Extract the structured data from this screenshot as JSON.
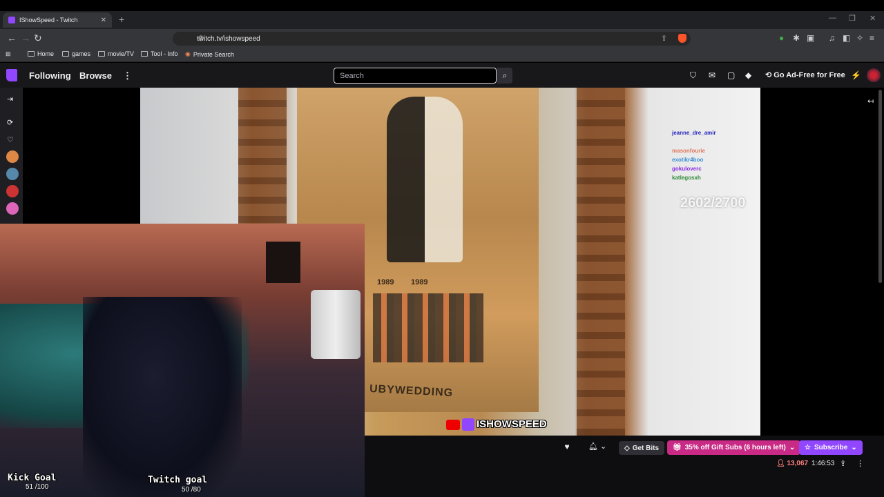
{
  "browser": {
    "tab_title": "IShowSpeed - Twitch",
    "tab_close": "✕",
    "new_tab": "+",
    "url": "twitch.tv/ishowspeed",
    "bookmarks": [
      "Home",
      "games",
      "movie/TV",
      "Tool - Info",
      "Private Search"
    ]
  },
  "twitch_nav": {
    "following": "Following",
    "browse": "Browse",
    "more": "⋮",
    "search_placeholder": "Search",
    "ad_free": "Go Ad-Free for Free"
  },
  "stream": {
    "chat_names": [
      {
        "name": "jeanne_dre_amir",
        "color": "#1f1fbf"
      },
      {
        "name": "masonfourie",
        "color": "#e0785a"
      },
      {
        "name": "exotikr4boo",
        "color": "#3a8fd6"
      },
      {
        "name": "gokuloverc",
        "color": "#8a2be2"
      },
      {
        "name": "katlegosxh",
        "color": "#2e8b3a"
      }
    ],
    "counter": "2602/2700",
    "watermark": "ISHOWSPEED",
    "photo_caption": "UBYWEDDING",
    "years": [
      "1989",
      "1989"
    ]
  },
  "webcam": {
    "kick_label": "Kick Goal",
    "kick_value": "51 /100",
    "twitch_label": "Twitch goal",
    "twitch_value": "50 /80"
  },
  "actions": {
    "get_bits": "Get Bits",
    "gift_subs": "35% off Gift Subs (6 hours left)",
    "subscribe": "Subscribe",
    "viewers": "13,067",
    "uptime": "1:46:53"
  },
  "colors": {
    "twitch_purple": "#9146ff",
    "gift_pink": "#c82a86",
    "live_red": "#ff8280"
  }
}
